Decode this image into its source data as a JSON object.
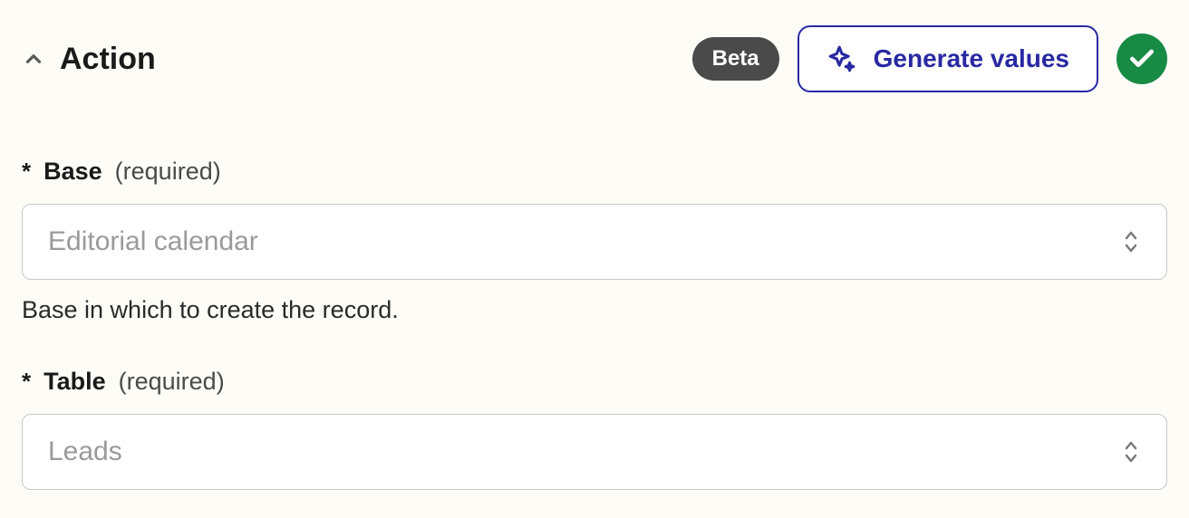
{
  "header": {
    "title": "Action",
    "beta_label": "Beta",
    "generate_label": "Generate values"
  },
  "fields": {
    "base": {
      "asterisk": "*",
      "label": "Base",
      "required_hint": "(required)",
      "value": "Editorial calendar",
      "help": "Base in which to create the record."
    },
    "table": {
      "asterisk": "*",
      "label": "Table",
      "required_hint": "(required)",
      "value": "Leads"
    }
  }
}
